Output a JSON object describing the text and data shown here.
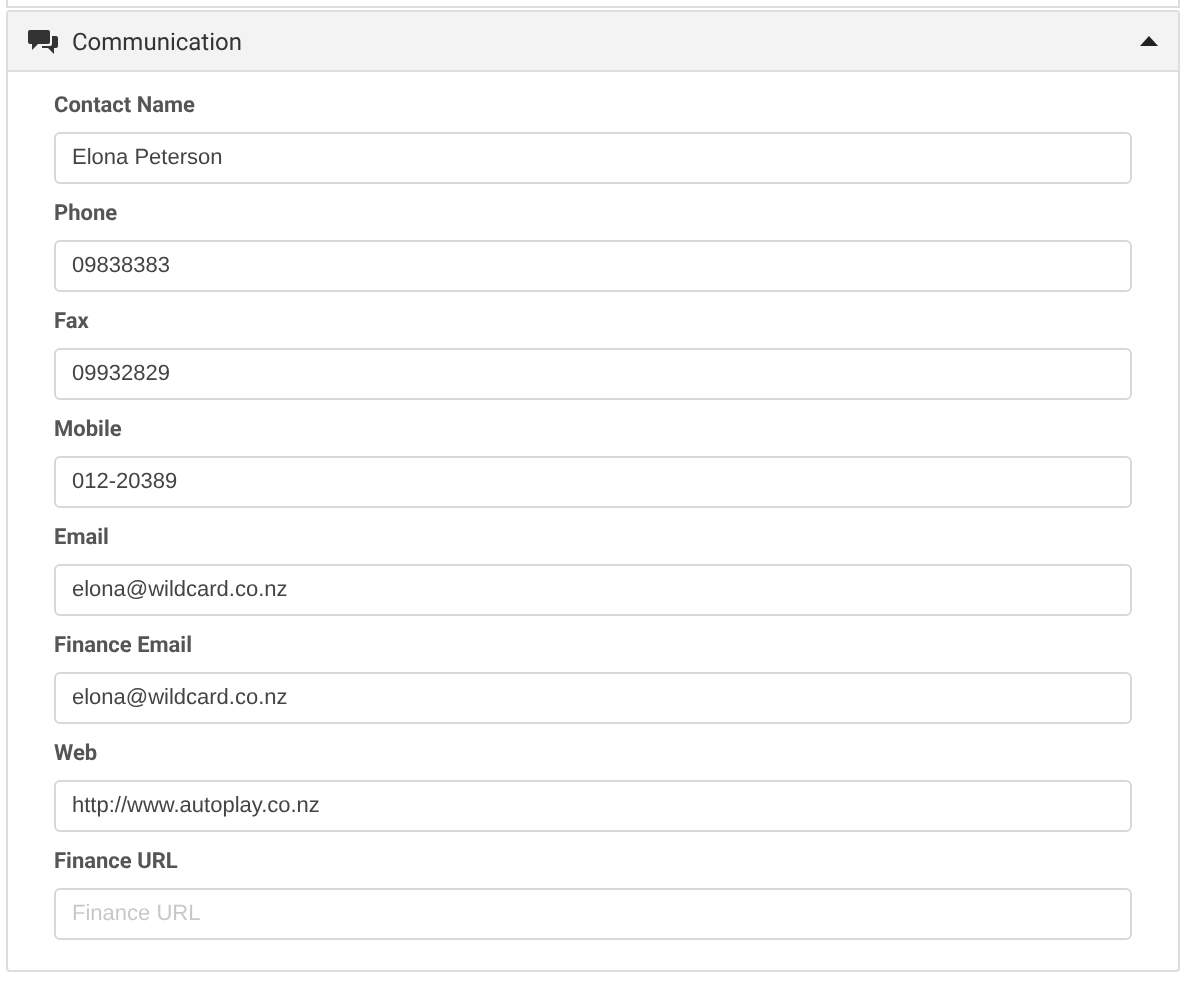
{
  "panel": {
    "title": "Communication",
    "expanded": true
  },
  "fields": [
    {
      "label": "Contact Name",
      "value": "Elona Peterson"
    },
    {
      "label": "Phone",
      "value": "09838383"
    },
    {
      "label": "Fax",
      "value": "09932829"
    },
    {
      "label": "Mobile",
      "value": "012-20389"
    },
    {
      "label": "Email",
      "value": "elona@wildcard.co.nz"
    },
    {
      "label": "Finance Email",
      "value": "elona@wildcard.co.nz"
    },
    {
      "label": "Web",
      "value": "http://www.autoplay.co.nz"
    },
    {
      "label": "Finance URL",
      "placeholder": "Finance URL"
    }
  ]
}
